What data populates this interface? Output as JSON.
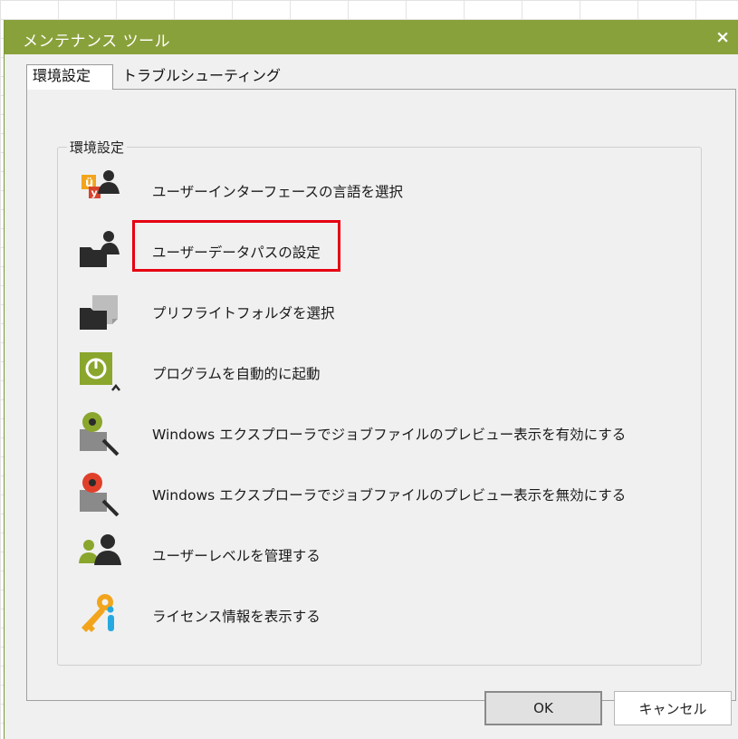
{
  "window": {
    "title": "メンテナンス ツール",
    "close_label": "×"
  },
  "tabs": [
    {
      "label": "環境設定",
      "active": true
    },
    {
      "label": "トラブルシューティング",
      "active": false
    }
  ],
  "group": {
    "label": "環境設定",
    "items": [
      {
        "label": "ユーザーインターフェースの言語を選択",
        "icon": "language-user-icon"
      },
      {
        "label": "ユーザーデータパスの設定",
        "icon": "user-folder-icon"
      },
      {
        "label": "プリフライトフォルダを選択",
        "icon": "preflight-folder-icon"
      },
      {
        "label": "プログラムを自動的に起動",
        "icon": "auto-start-icon"
      },
      {
        "label": "Windows エクスプローラでジョブファイルのプレビュー表示を有効にする",
        "icon": "preview-enable-icon"
      },
      {
        "label": "Windows エクスプローラでジョブファイルのプレビュー表示を無効にする",
        "icon": "preview-disable-icon"
      },
      {
        "label": "ユーザーレベルを管理する",
        "icon": "user-level-icon"
      },
      {
        "label": "ライセンス情報を表示する",
        "icon": "license-key-icon"
      }
    ]
  },
  "buttons": {
    "ok": "OK",
    "cancel": "キャンセル"
  },
  "colors": {
    "titlebar": "#89a13a",
    "accent_green": "#8aa62d",
    "highlight": "#e60012",
    "icon_dark": "#2b2b2b"
  }
}
